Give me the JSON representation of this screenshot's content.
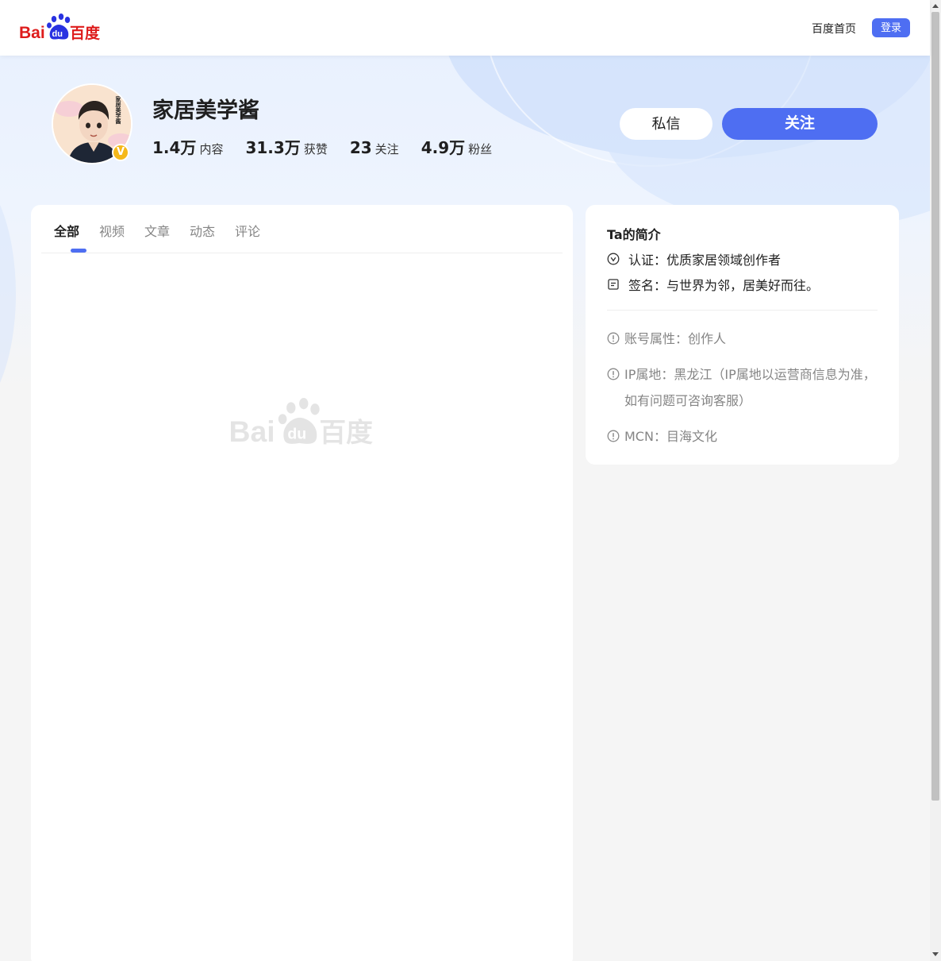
{
  "header": {
    "logo_text": "Bai百度",
    "home_link": "百度首页",
    "login_label": "登录"
  },
  "profile": {
    "name": "家居美学酱",
    "verified_badge": "V",
    "avatar_text": "家居美学酱",
    "stats": [
      {
        "num": "1.4万",
        "label": "内容"
      },
      {
        "num": "31.3万",
        "label": "获赞"
      },
      {
        "num": "23",
        "label": "关注"
      },
      {
        "num": "4.9万",
        "label": "粉丝"
      }
    ],
    "message_label": "私信",
    "follow_label": "关注"
  },
  "tabs": [
    "全部",
    "视频",
    "文章",
    "动态",
    "评论"
  ],
  "intro": {
    "title": "Ta的简介",
    "certification": "认证：优质家居领域创作者",
    "signature": "签名：与世界为邻，居美好而往。",
    "account_type": "账号属性：创作人",
    "ip_line1": "IP属地：黑龙江（IP属地以运营商信息为准，",
    "ip_line2": "如有问题可咨询客服）",
    "mcn": "MCN：目海文化"
  },
  "colors": {
    "accent": "#4e6ef2",
    "badge": "#f5b819",
    "logo_red": "#de1c1c",
    "logo_blue": "#2932e1"
  }
}
